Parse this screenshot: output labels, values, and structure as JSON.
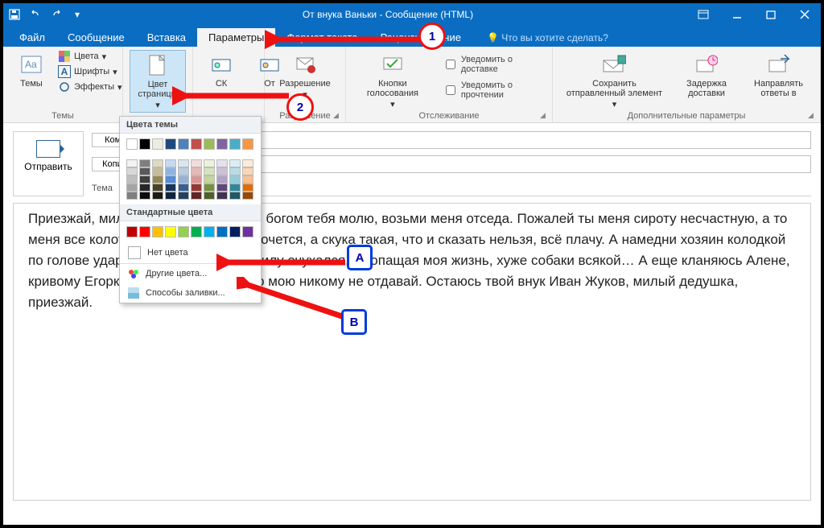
{
  "title": "От внука Ваньки - Сообщение (HTML)",
  "tabs": {
    "file": "Файл",
    "message": "Сообщение",
    "insert": "Вставка",
    "options": "Параметры",
    "format": "Формат текста",
    "review": "Рецензирование",
    "tell": "Что вы хотите сделать?"
  },
  "ribbon": {
    "themes": {
      "label": "Темы",
      "title": "Темы",
      "colors": "Цвета",
      "fonts": "Шрифты",
      "effects": "Эффекты",
      "pageColor": "Цвет страницы"
    },
    "fields": {
      "bcc": "СК",
      "from": "От"
    },
    "permission": {
      "title": "Разрешение",
      "label": "Разрешение"
    },
    "tracking": {
      "vote": "Кнопки голосования",
      "delivery": "Уведомить о доставке",
      "read": "Уведомить о прочтении",
      "label": "Отслеживание"
    },
    "more": {
      "save": "Сохранить отправленный элемент",
      "delay": "Задержка доставки",
      "direct": "Направлять ответы в",
      "label": "Дополнительные параметры"
    }
  },
  "compose": {
    "send": "Отправить",
    "to": "Кому...",
    "cc": "Копия...",
    "subject": "Тема"
  },
  "palette": {
    "theme": "Цвета темы",
    "standard": "Стандартные цвета",
    "none": "Нет цвета",
    "more": "Другие цвета...",
    "fill": "Способы заливки...",
    "themeColors": [
      "#ffffff",
      "#000000",
      "#eeece1",
      "#1f497d",
      "#4f81bd",
      "#c0504d",
      "#9bbb59",
      "#8064a2",
      "#4bacc6",
      "#f79646"
    ],
    "themeShades": [
      [
        "#f2f2f2",
        "#7f7f7f",
        "#ddd9c3",
        "#c6d9f0",
        "#dbe5f1",
        "#f2dcdb",
        "#ebf1dd",
        "#e5e0ec",
        "#dbeef3",
        "#fdeada"
      ],
      [
        "#d8d8d8",
        "#595959",
        "#c4bd97",
        "#8db3e2",
        "#b8cce4",
        "#e5b9b7",
        "#d7e3bc",
        "#ccc1d9",
        "#b7dde8",
        "#fbd5b5"
      ],
      [
        "#bfbfbf",
        "#3f3f3f",
        "#938953",
        "#548dd4",
        "#95b3d7",
        "#d99694",
        "#c3d69b",
        "#b2a2c7",
        "#92cddc",
        "#fac08f"
      ],
      [
        "#a5a5a5",
        "#262626",
        "#494429",
        "#17365d",
        "#366092",
        "#953734",
        "#76923c",
        "#5f497a",
        "#31859b",
        "#e36c09"
      ],
      [
        "#7f7f7f",
        "#0c0c0c",
        "#1d1b10",
        "#0f243e",
        "#244061",
        "#632423",
        "#4f6128",
        "#3f3151",
        "#205867",
        "#974806"
      ]
    ],
    "standardColors": [
      "#c00000",
      "#ff0000",
      "#ffc000",
      "#ffff00",
      "#92d050",
      "#00b050",
      "#00b0f0",
      "#0070c0",
      "#002060",
      "#7030a0"
    ]
  },
  "bodyText": "Приезжай, милый дедушка, Христом богом тебя молю, возьми меня отседа. Пожалей ты меня сироту несчастную, а то меня все колотят и кушать страсть хочется, а скука такая, что и сказать нельзя, всё плачу. А намедни хозяин колодкой по голове ударил, так что упал и насилу очухался. Пропащая моя жизнь, хуже собаки всякой… А еще кланяюсь Алене, кривому Егорке и кучеру, а гармонию мою никому не отдавай. Остаюсь твой внук Иван Жуков, милый дедушка, приезжай.",
  "callouts": {
    "c1": "1",
    "c2": "2",
    "cA": "А",
    "cB": "В"
  }
}
